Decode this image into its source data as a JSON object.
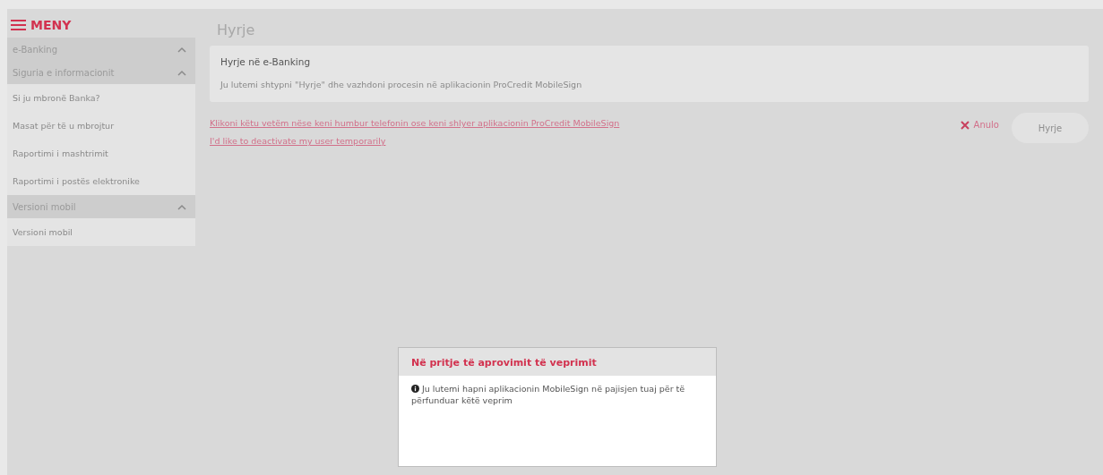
{
  "menu": {
    "title": "MENY"
  },
  "sidebar": {
    "groups": [
      {
        "label": "e-Banking",
        "expanded": true
      },
      {
        "label": "Siguria e informacionit",
        "expanded": true,
        "children": [
          "Si ju mbronë Banka?",
          "Masat për të u mbrojtur",
          "Raportimi i mashtrimit",
          "Raportimi i postës elektronike"
        ]
      },
      {
        "label": "Versioni mobil",
        "expanded": true,
        "children": [
          "Versioni mobil"
        ]
      }
    ]
  },
  "page": {
    "title": "Hyrje"
  },
  "card": {
    "title": "Hyrje në e-Banking",
    "text": "Ju lutemi shtypni \"Hyrje\" dhe vazhdoni procesin në aplikacionin ProCredit MobileSign"
  },
  "links": [
    "Klikoni këtu vetëm nëse keni humbur telefonin ose keni shlyer aplikacionin ProCredit MobileSign",
    "I'd like to deactivate my user temporarily"
  ],
  "actions": {
    "cancel": "Anulo",
    "submit": {
      "label": "Hyrje",
      "disabled": true
    }
  },
  "dialog": {
    "title": "Në pritje të aprovimit të veprimit",
    "message": "Ju lutemi hapni aplikacionin MobileSign në pajisjen tuaj për të përfunduar këtë veprim"
  }
}
